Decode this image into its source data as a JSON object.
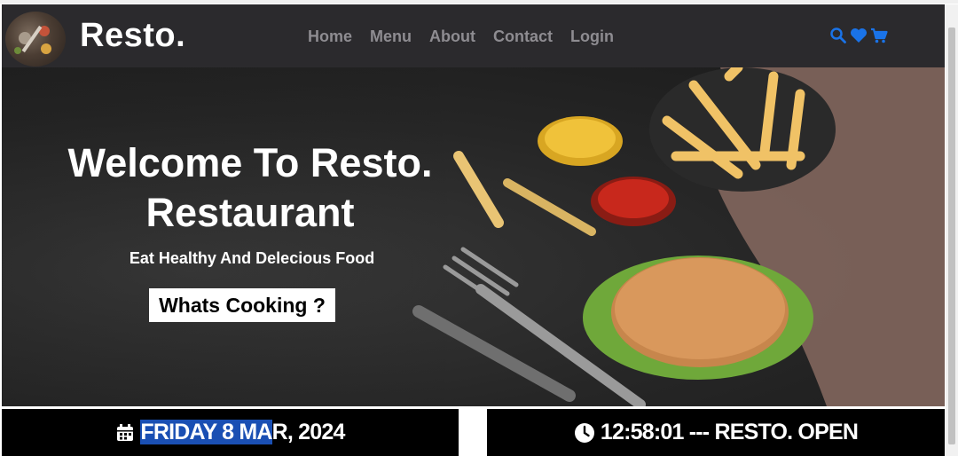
{
  "brand": {
    "name": "Resto.",
    "logo_icon": "spices-logo-icon"
  },
  "nav": {
    "links": [
      "Home",
      "Menu",
      "About",
      "Contact",
      "Login"
    ],
    "icons": [
      "search-icon",
      "heart-icon",
      "cart-icon"
    ],
    "link_color": "#8e8c91",
    "icon_color": "#1a73e8"
  },
  "hero": {
    "title_line1": "Welcome To Resto.",
    "title_line2": "Restaurant",
    "subtitle": "Eat Healthy And Delecious Food",
    "button_label": "Whats Cooking ?"
  },
  "footer_bar": {
    "date_highlight": "FRIDAY 8 MA",
    "date_rest": "R, 2024",
    "date_icon": "calendar-icon",
    "time_text": "12:58:01 --- RESTO. OPEN",
    "time_icon": "clock-icon"
  }
}
